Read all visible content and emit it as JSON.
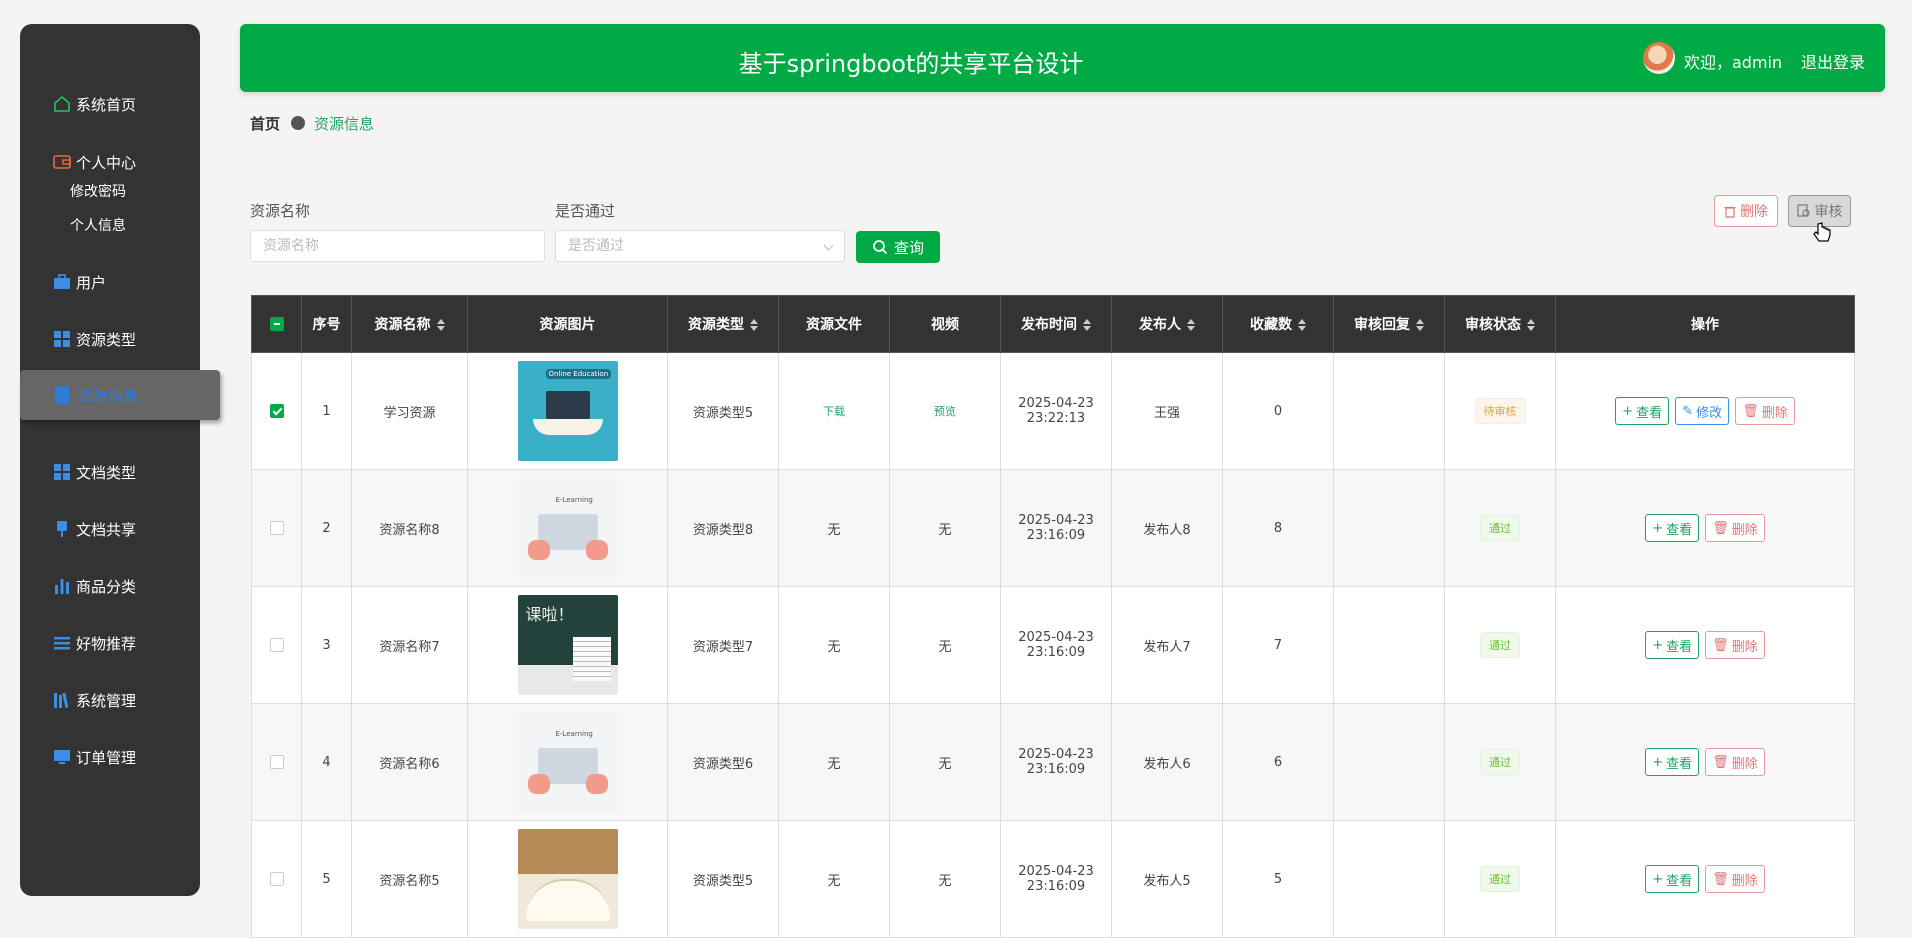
{
  "header": {
    "title": "基于springboot的共享平台设计",
    "welcome": "欢迎，admin",
    "logout": "退出登录"
  },
  "sidebar": {
    "home": "系统首页",
    "personal_center": "个人中心",
    "change_password": "修改密码",
    "personal_info": "个人信息",
    "user": "用户",
    "resource_type": "资源类型",
    "resource_info": "资源信息",
    "doc_type": "文档类型",
    "doc_share": "文档共享",
    "goods_category": "商品分类",
    "recommend": "好物推荐",
    "system": "系统管理",
    "orders": "订单管理"
  },
  "breadcrumb": {
    "home": "首页",
    "current": "资源信息"
  },
  "search": {
    "name_label": "资源名称",
    "name_placeholder": "资源名称",
    "approved_label": "是否通过",
    "approved_placeholder": "是否通过",
    "query": "查询"
  },
  "toolbar": {
    "delete": "删除",
    "audit": "审核"
  },
  "table": {
    "headers": [
      "序号",
      "资源名称",
      "资源图片",
      "资源类型",
      "资源文件",
      "视频",
      "发布时间",
      "发布人",
      "收藏数",
      "审核回复",
      "审核状态",
      "操作"
    ],
    "rows": [
      {
        "no": "1",
        "name": "学习资源",
        "type": "资源类型5",
        "file": "下载",
        "video": "预览",
        "time": "2025-04-23 23:22:13",
        "publisher": "王强",
        "fav": "0",
        "reply": "",
        "status": "待审核"
      },
      {
        "no": "2",
        "name": "资源名称8",
        "type": "资源类型8",
        "file": "无",
        "video": "无",
        "time": "2025-04-23 23:16:09",
        "publisher": "发布人8",
        "fav": "8",
        "reply": "",
        "status": "通过"
      },
      {
        "no": "3",
        "name": "资源名称7",
        "type": "资源类型7",
        "file": "无",
        "video": "无",
        "time": "2025-04-23 23:16:09",
        "publisher": "发布人7",
        "fav": "7",
        "reply": "",
        "status": "通过"
      },
      {
        "no": "4",
        "name": "资源名称6",
        "type": "资源类型6",
        "file": "无",
        "video": "无",
        "time": "2025-04-23 23:16:09",
        "publisher": "发布人6",
        "fav": "6",
        "reply": "",
        "status": "通过"
      },
      {
        "no": "5",
        "name": "资源名称5",
        "type": "资源类型5",
        "file": "无",
        "video": "无",
        "time": "2025-04-23 23:16:09",
        "publisher": "发布人5",
        "fav": "5",
        "reply": "",
        "status": "通过"
      }
    ],
    "actions": {
      "view": "查看",
      "edit": "修改",
      "delete": "删除"
    },
    "image_labels": {
      "online_education": "Online Education",
      "e_learning": "E-Learning",
      "class": "课啦！"
    }
  },
  "colors": {
    "primary": "#00aa45",
    "sidebar": "#333333",
    "active_text": "#2e7bd8"
  }
}
